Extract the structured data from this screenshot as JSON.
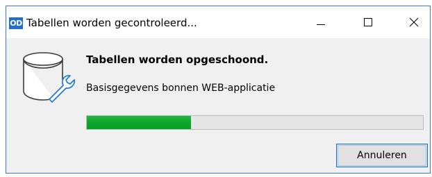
{
  "window": {
    "logo_text": "OD",
    "title": "Tabellen worden gecontroleerd...",
    "controls": {
      "minimize_icon": "minimize-icon",
      "maximize_icon": "maximize-icon",
      "close_icon": "close-icon"
    }
  },
  "dialog": {
    "icon": "database-wrench-icon",
    "heading": "Tabellen worden opgeschoond.",
    "status": "Basisgegevens bonnen WEB-applicatie",
    "progress_fraction": 0.31,
    "cancel_label": "Annuleren"
  },
  "colors": {
    "accent_border": "#3b78c7",
    "progress_green": "#0fa52d",
    "logo_blue": "#1f6fd3"
  }
}
